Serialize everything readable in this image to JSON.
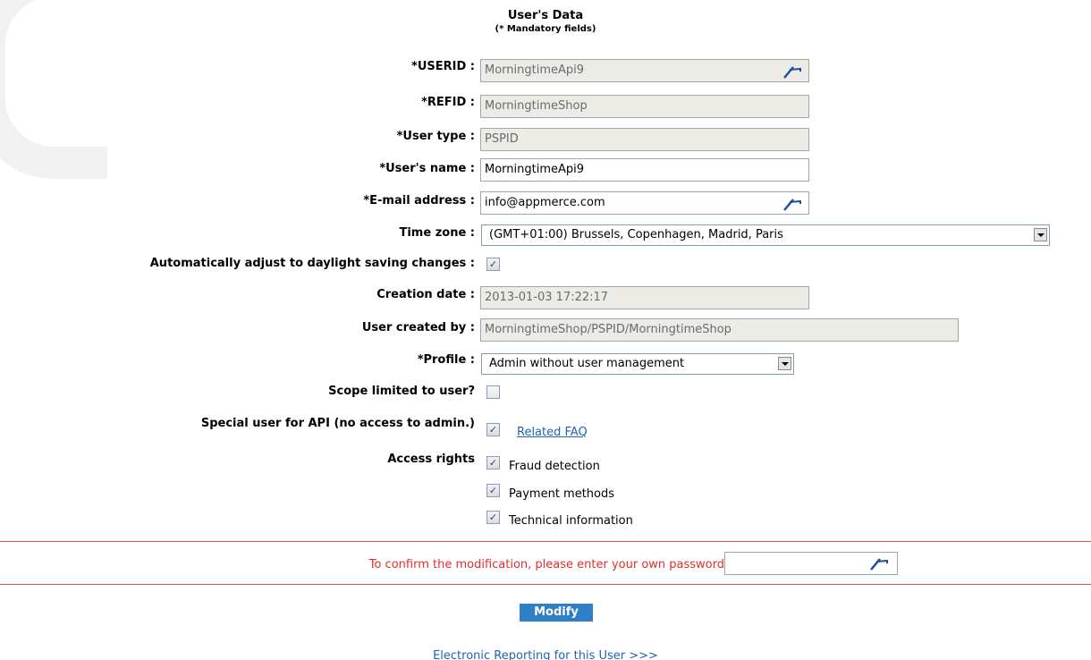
{
  "header": {
    "title": "User's Data",
    "subtitle": "(* Mandatory fields)"
  },
  "fields": {
    "userid": {
      "label": "*USERID :",
      "value": "MorningtimeApi9"
    },
    "refid": {
      "label": "*REFID :",
      "value": "MorningtimeShop"
    },
    "user_type": {
      "label": "*User type :",
      "value": "PSPID"
    },
    "user_name": {
      "label": "*User's name :",
      "value": "MorningtimeApi9"
    },
    "email": {
      "label": "*E-mail address :",
      "value": "info@appmerce.com"
    },
    "time_zone": {
      "label": "Time zone :",
      "value": "(GMT+01:00) Brussels, Copenhagen, Madrid, Paris"
    },
    "daylight": {
      "label": "Automatically adjust to daylight saving changes :",
      "checked": true
    },
    "creation_date": {
      "label": "Creation date :",
      "value": "2013-01-03 17:22:17"
    },
    "created_by": {
      "label": "User created by :",
      "value": "MorningtimeShop/PSPID/MorningtimeShop"
    },
    "profile": {
      "label": "*Profile :",
      "value": "Admin without user management"
    },
    "scope": {
      "label": "Scope limited to user?",
      "checked": false
    },
    "special_api": {
      "label": "Special user for API (no access to admin.)",
      "checked": true,
      "link": "Related FAQ"
    },
    "access_rights": {
      "label": "Access rights",
      "items": [
        {
          "label": "Fraud detection",
          "checked": true
        },
        {
          "label": "Payment methods",
          "checked": true
        },
        {
          "label": "Technical information",
          "checked": true
        }
      ]
    }
  },
  "confirm": {
    "text": "To confirm the modification, please enter your own password",
    "password_value": ""
  },
  "actions": {
    "modify_label": "Modify",
    "report_link": "Electronic Reporting for this User >>>"
  },
  "colors": {
    "readonly_bg": "#ecebe5",
    "link": "#1f63b3",
    "alert_red": "#e22d2d",
    "button_blue": "#2f7fc7"
  }
}
